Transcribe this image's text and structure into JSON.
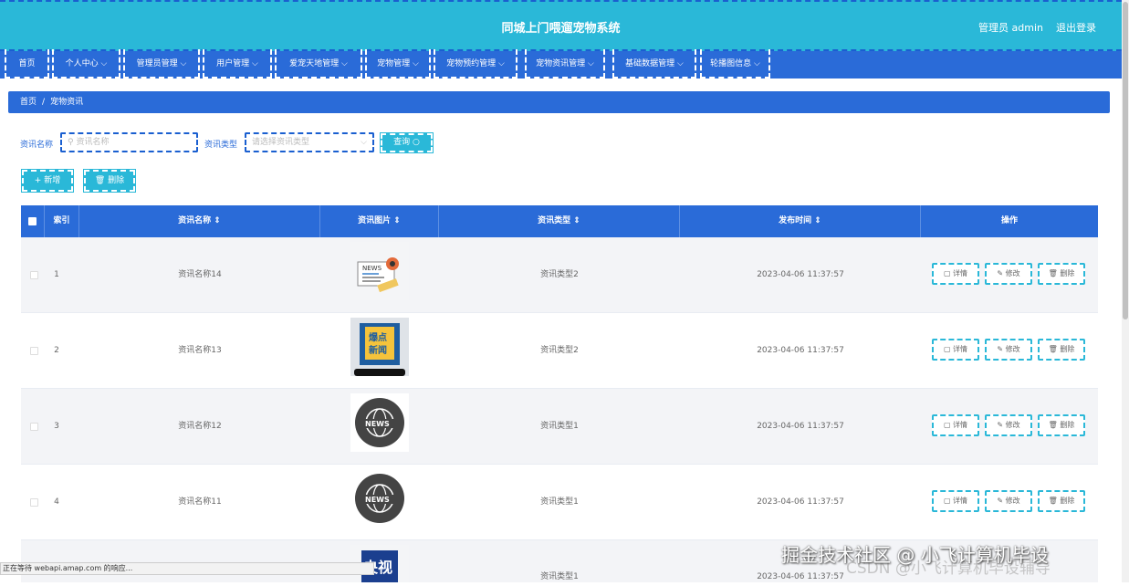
{
  "header": {
    "title": "同城上门喂遛宠物系统",
    "user": "管理员 admin",
    "logout": "退出登录"
  },
  "nav": [
    {
      "label": "首页"
    },
    {
      "label": "个人中心 ⌵"
    },
    {
      "label": "管理员管理 ⌵"
    },
    {
      "label": "用户管理 ⌵"
    },
    {
      "label": "爱宠天地管理 ⌵"
    },
    {
      "label": "宠物管理 ⌵"
    },
    {
      "label": "宠物预约管理 ⌵"
    },
    {
      "label": "宠物资讯管理 ⌵"
    },
    {
      "label": "基础数据管理 ⌵"
    },
    {
      "label": "轮播图信息 ⌵"
    }
  ],
  "breadcrumb": {
    "home": "首页",
    "sep": "/",
    "current": "宠物资讯"
  },
  "search": {
    "name_label": "资讯名称",
    "name_placeholder": "资讯名称",
    "type_label": "资讯类型",
    "type_placeholder": "请选择资讯类型",
    "query_button": "查询 ○"
  },
  "actions": {
    "add": "+ 新增",
    "delete": "🗑 删除"
  },
  "table": {
    "headers": [
      "索引",
      "资讯名称 ⇕",
      "资讯图片 ⇕",
      "资讯类型 ⇕",
      "发布时间 ⇕",
      "操作"
    ],
    "rows": [
      {
        "index": "1",
        "name": "资讯名称14",
        "image": "news-paper-illustration",
        "type": "资讯类型2",
        "time": "2023-04-06 11:37:57"
      },
      {
        "index": "2",
        "name": "资讯名称13",
        "image": "baodian-xinwen-phone",
        "type": "资讯类型2",
        "time": "2023-04-06 11:37:57"
      },
      {
        "index": "3",
        "name": "资讯名称12",
        "image": "news-globe-badge",
        "type": "资讯类型1",
        "time": "2023-04-06 11:37:57"
      },
      {
        "index": "4",
        "name": "资讯名称11",
        "image": "news-globe-badge",
        "type": "资讯类型1",
        "time": "2023-04-06 11:37:57"
      },
      {
        "index": "",
        "name": "",
        "image": "cctv-logo",
        "type": "资讯类型1",
        "time": "2023-04-06 11:37:57"
      }
    ],
    "row_actions": {
      "detail": "详情",
      "edit": "修改",
      "delete": "删除"
    }
  },
  "image_text": {
    "news": "NEWS",
    "baodian": "爆点",
    "xinwen": "新闻",
    "cctv": "央视"
  },
  "status_bar": "正在等待 webapi.amap.com 的响应...",
  "watermark": {
    "line1": "掘金技术社区 @ 小飞计算机毕设",
    "line2": "CSDN @小飞计算机毕设辅导"
  },
  "colors": {
    "primary": "#2a6bd8",
    "accent": "#2ab8d8"
  }
}
